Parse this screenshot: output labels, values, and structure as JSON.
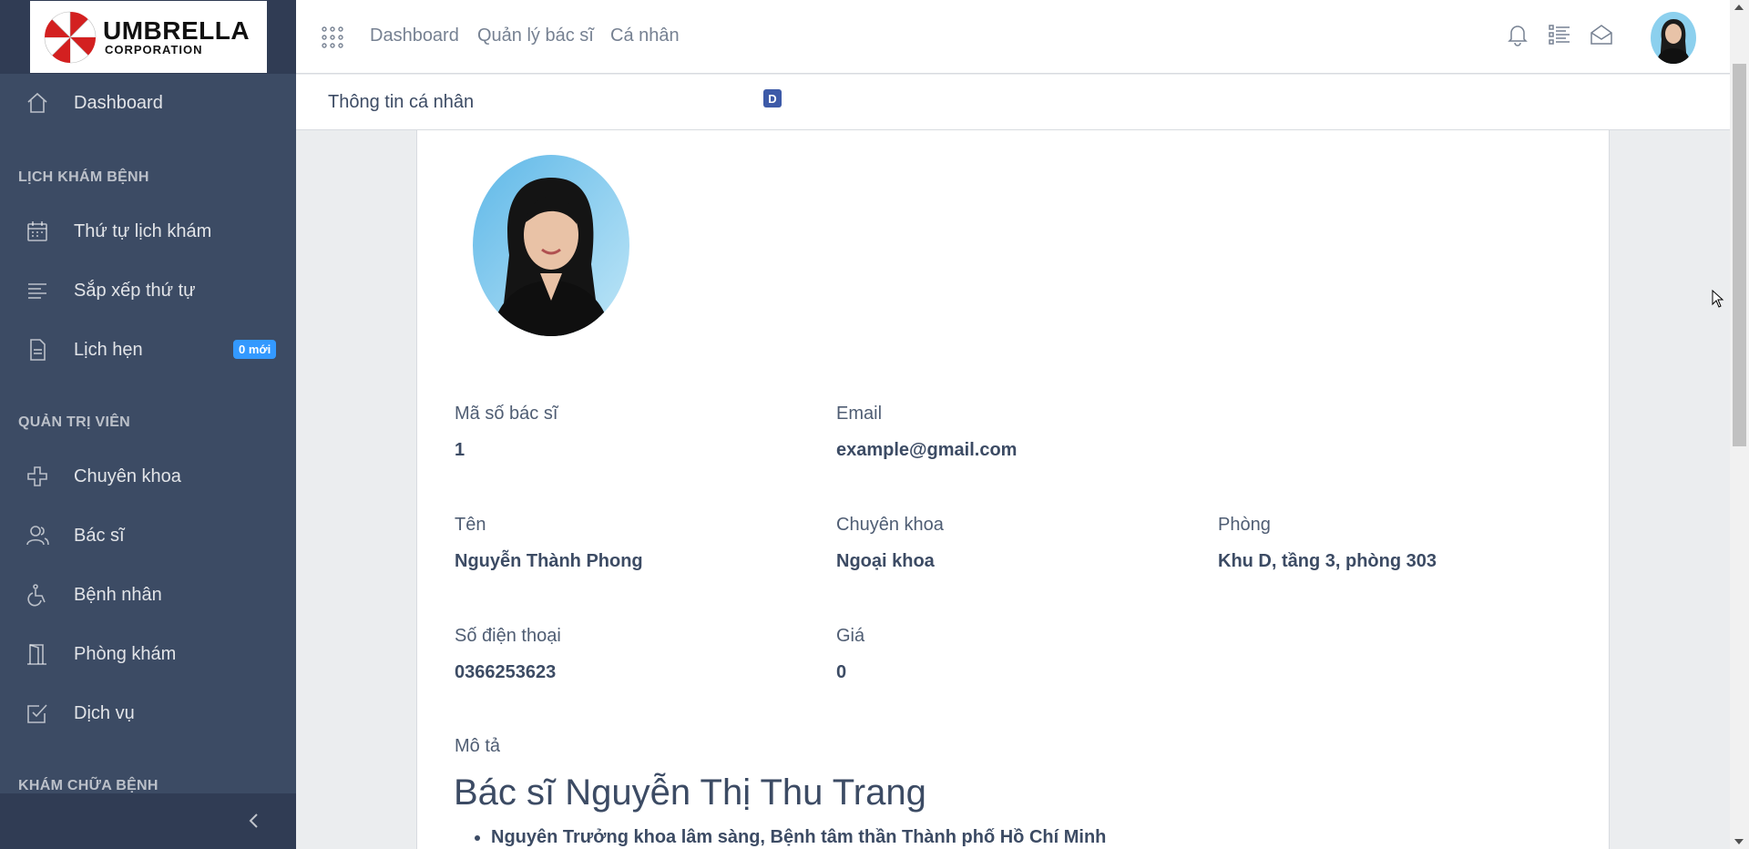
{
  "brand": {
    "name": "UMBRELLA",
    "subname": "CORPORATION"
  },
  "sidebar": {
    "dashboard": "Dashboard",
    "sections": [
      {
        "title": "LỊCH KHÁM BỆNH",
        "items": [
          {
            "label": "Thứ tự lịch khám",
            "icon": "calendar-icon"
          },
          {
            "label": "Sắp xếp thứ tự",
            "icon": "sort-lines-icon"
          },
          {
            "label": "Lịch hẹn",
            "icon": "document-icon",
            "badge": "0 mới"
          }
        ]
      },
      {
        "title": "QUẢN TRỊ VIÊN",
        "items": [
          {
            "label": "Chuyên khoa",
            "icon": "medical-cross-icon"
          },
          {
            "label": "Bác sĩ",
            "icon": "users-icon"
          },
          {
            "label": "Bệnh nhân",
            "icon": "wheelchair-icon"
          },
          {
            "label": "Phòng khám",
            "icon": "door-icon"
          },
          {
            "label": "Dịch vụ",
            "icon": "check-square-icon"
          }
        ]
      },
      {
        "title": "KHÁM CHỮA BỆNH",
        "items": []
      }
    ]
  },
  "header": {
    "nav": [
      "Dashboard",
      "Quản lý bác sĩ",
      "Cá nhân"
    ]
  },
  "subheader": {
    "breadcrumb": "Thông tin cá nhân",
    "badge": "D"
  },
  "profile": {
    "fields": {
      "doctor_id": {
        "label": "Mã số bác sĩ",
        "value": "1"
      },
      "email": {
        "label": "Email",
        "value": "example@gmail.com"
      },
      "name": {
        "label": "Tên",
        "value": "Nguyễn Thành Phong"
      },
      "specialty": {
        "label": "Chuyên khoa",
        "value": "Ngoại khoa"
      },
      "room": {
        "label": "Phòng",
        "value": "Khu D, tầng 3, phòng 303"
      },
      "phone": {
        "label": "Số điện thoại",
        "value": "0366253623"
      },
      "price": {
        "label": "Giá",
        "value": "0"
      }
    },
    "description_label": "Mô tả",
    "description_title": "Bác sĩ Nguyễn Thị Thu Trang",
    "description_items": [
      "Nguyên Trưởng khoa lâm sàng, Bệnh tâm thần Thành phố Hồ Chí Minh"
    ]
  },
  "colors": {
    "sidebar": "#3c4b64",
    "sidebar_dark": "#303c54",
    "badge": "#3399ff",
    "page_bg": "#ebedef"
  }
}
